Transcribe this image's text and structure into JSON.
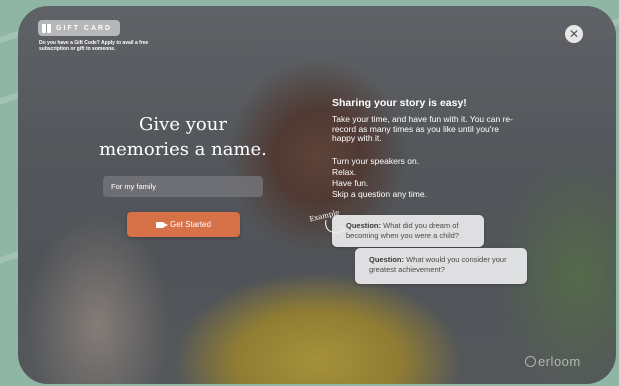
{
  "gift": {
    "badge_label": "GIFT CARD",
    "description": "Do you have a Gift Code? Apply to avail a free subscription or gift to someone."
  },
  "form": {
    "headline": "Give your memories a name.",
    "input_value": "For my family",
    "start_label": "Get Started"
  },
  "story": {
    "title": "Sharing your story is easy!",
    "body": "Take your time, and have fun with it. You can re-record as many times as you like until you're happy with it.",
    "tips": [
      "Turn your speakers on.",
      "Relax.",
      "Have fun.",
      "Skip a question any time."
    ]
  },
  "examples": {
    "label": "Example",
    "questions": [
      {
        "prefix": "Question:",
        "text": "What did you dream of becoming when you were a child?"
      },
      {
        "prefix": "Question:",
        "text": "What would you consider your greatest achievement?"
      }
    ]
  },
  "brand": {
    "logo_text": "erloom"
  },
  "colors": {
    "accent": "#d77148",
    "background": "#8fb5a4"
  },
  "icons": {
    "close": "close-icon",
    "gift": "gift-icon",
    "camera": "video-camera-icon"
  }
}
